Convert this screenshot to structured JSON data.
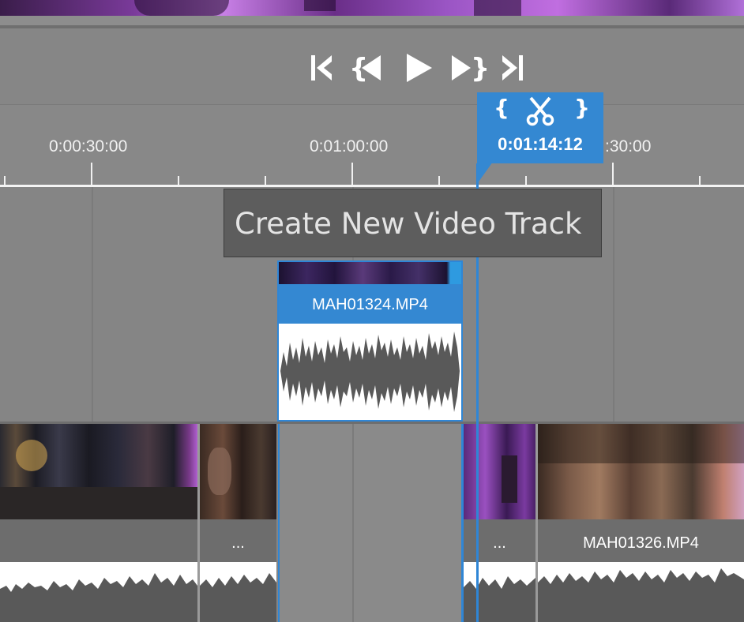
{
  "colors": {
    "accent": "#3488d2",
    "tooltip_bg": "#5d5d5d",
    "track_bg": "#858585",
    "label_bar": "#6d6d6d",
    "waveform": "#595959"
  },
  "transport": {
    "buttons": [
      {
        "name": "go-to-start",
        "icon": "skip-to-start-icon"
      },
      {
        "name": "previous-edit",
        "icon": "previous-edit-icon"
      },
      {
        "name": "play",
        "icon": "play-icon"
      },
      {
        "name": "next-edit",
        "icon": "next-edit-icon"
      },
      {
        "name": "go-to-end",
        "icon": "skip-to-end-icon"
      }
    ]
  },
  "ruler": {
    "labels": [
      "0:00:30:00",
      "0:01:00:00",
      ":30:00"
    ]
  },
  "playhead": {
    "time": "0:01:14:12",
    "bracket_left": "{",
    "bracket_right": "}",
    "split_icon": "scissors-icon"
  },
  "tooltip": {
    "text": "Create New Video Track"
  },
  "clips": {
    "selected": {
      "name": "MAH01324.MP4"
    },
    "lower": [
      {
        "name": ""
      },
      {
        "name": "..."
      },
      {
        "name": "..."
      },
      {
        "name": "MAH01326.MP4"
      }
    ]
  }
}
